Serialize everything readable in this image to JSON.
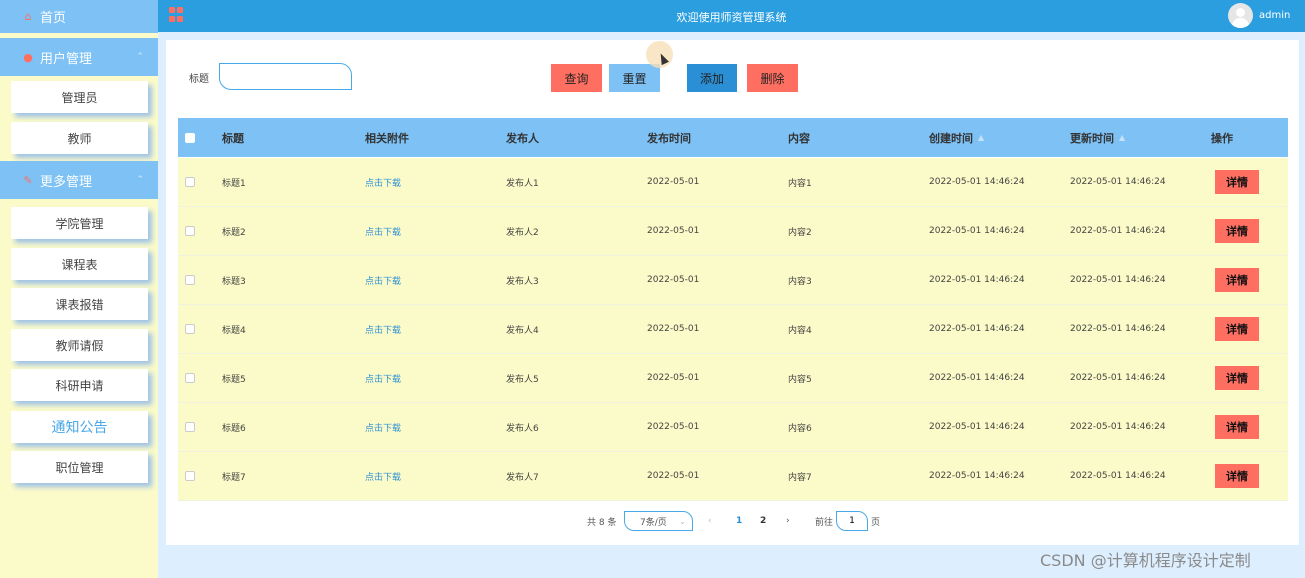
{
  "header": {
    "title": "欢迎使用师资管理系统",
    "username": "admin"
  },
  "sidebar": {
    "home": "首页",
    "groups": [
      {
        "label": "用户管理",
        "items": [
          "管理员",
          "教师"
        ]
      },
      {
        "label": "更多管理",
        "items": [
          "学院管理",
          "课程表",
          "课表报错",
          "教师请假",
          "科研申请",
          "通知公告",
          "职位管理"
        ]
      }
    ],
    "active_item": "通知公告"
  },
  "search": {
    "label": "标题",
    "value": "",
    "placeholder": ""
  },
  "buttons": {
    "query": "查询",
    "reset": "重置",
    "add": "添加",
    "delete": "删除"
  },
  "table": {
    "columns": [
      "标题",
      "相关附件",
      "发布人",
      "发布时间",
      "内容",
      "创建时间",
      "更新时间",
      "操作"
    ],
    "rows": [
      {
        "title": "标题1",
        "attachment": "点击下载",
        "publisher": "发布人1",
        "publish_time": "2022-05-01",
        "content": "内容1",
        "created": "2022-05-01 14:46:24",
        "updated": "2022-05-01 14:46:24",
        "action": "详情"
      },
      {
        "title": "标题2",
        "attachment": "点击下载",
        "publisher": "发布人2",
        "publish_time": "2022-05-01",
        "content": "内容2",
        "created": "2022-05-01 14:46:24",
        "updated": "2022-05-01 14:46:24",
        "action": "详情"
      },
      {
        "title": "标题3",
        "attachment": "点击下载",
        "publisher": "发布人3",
        "publish_time": "2022-05-01",
        "content": "内容3",
        "created": "2022-05-01 14:46:24",
        "updated": "2022-05-01 14:46:24",
        "action": "详情"
      },
      {
        "title": "标题4",
        "attachment": "点击下载",
        "publisher": "发布人4",
        "publish_time": "2022-05-01",
        "content": "内容4",
        "created": "2022-05-01 14:46:24",
        "updated": "2022-05-01 14:46:24",
        "action": "详情"
      },
      {
        "title": "标题5",
        "attachment": "点击下载",
        "publisher": "发布人5",
        "publish_time": "2022-05-01",
        "content": "内容5",
        "created": "2022-05-01 14:46:24",
        "updated": "2022-05-01 14:46:24",
        "action": "详情"
      },
      {
        "title": "标题6",
        "attachment": "点击下载",
        "publisher": "发布人6",
        "publish_time": "2022-05-01",
        "content": "内容6",
        "created": "2022-05-01 14:46:24",
        "updated": "2022-05-01 14:46:24",
        "action": "详情"
      },
      {
        "title": "标题7",
        "attachment": "点击下载",
        "publisher": "发布人7",
        "publish_time": "2022-05-01",
        "content": "内容7",
        "created": "2022-05-01 14:46:24",
        "updated": "2022-05-01 14:46:24",
        "action": "详情"
      }
    ]
  },
  "pagination": {
    "total": "共 8 条",
    "page_size": "7条/页",
    "prev": "‹",
    "pages": [
      "1",
      "2"
    ],
    "next": "›",
    "goto_label": "前往",
    "goto_value": "1",
    "page_suffix": "页"
  },
  "watermark": "CSDN @计算机程序设计定制",
  "colors": {
    "primary": "#2b9ee0",
    "sidebar_header": "#7dc1f5",
    "sidebar_bg": "#fbfbc9",
    "row_bg": "#fbfbc9",
    "danger": "#ff6f61",
    "add": "#2b8fd5"
  }
}
